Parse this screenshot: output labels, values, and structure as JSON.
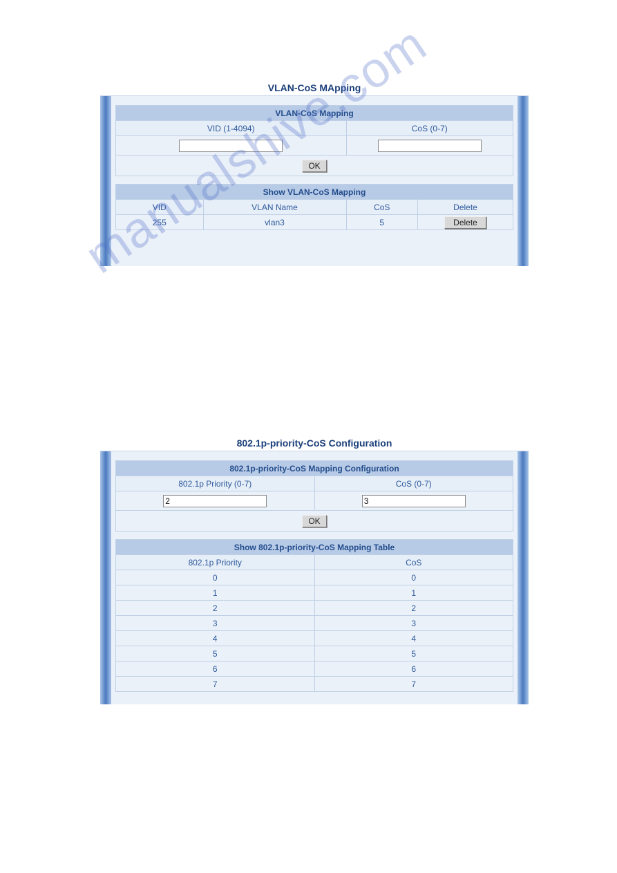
{
  "watermark": "manualshive.com",
  "panel1": {
    "title": "VLAN-CoS MApping",
    "section1": {
      "header": "VLAN-CoS Mapping",
      "col1": "VID (1-4094)",
      "col2": "CoS (0-7)",
      "vid_value": "",
      "cos_value": "",
      "ok_label": "OK"
    },
    "section2": {
      "header": "Show VLAN-CoS Mapping",
      "col1": "VID",
      "col2": "VLAN Name",
      "col3": "CoS",
      "col4": "Delete",
      "rows": [
        {
          "vid": "255",
          "vlan_name": "vlan3",
          "cos": "5",
          "delete_label": "Delete"
        }
      ]
    }
  },
  "panel2": {
    "title": "802.1p-priority-CoS Configuration",
    "section1": {
      "header": "802.1p-priority-CoS Mapping Configuration",
      "col1": "802.1p Priority (0-7)",
      "col2": "CoS (0-7)",
      "priority_value": "2",
      "cos_value": "3",
      "ok_label": "OK"
    },
    "section2": {
      "header": "Show 802.1p-priority-CoS Mapping Table",
      "col1": "802.1p Priority",
      "col2": "CoS",
      "rows": [
        {
          "priority": "0",
          "cos": "0"
        },
        {
          "priority": "1",
          "cos": "1"
        },
        {
          "priority": "2",
          "cos": "2"
        },
        {
          "priority": "3",
          "cos": "3"
        },
        {
          "priority": "4",
          "cos": "4"
        },
        {
          "priority": "5",
          "cos": "5"
        },
        {
          "priority": "6",
          "cos": "6"
        },
        {
          "priority": "7",
          "cos": "7"
        }
      ]
    }
  }
}
